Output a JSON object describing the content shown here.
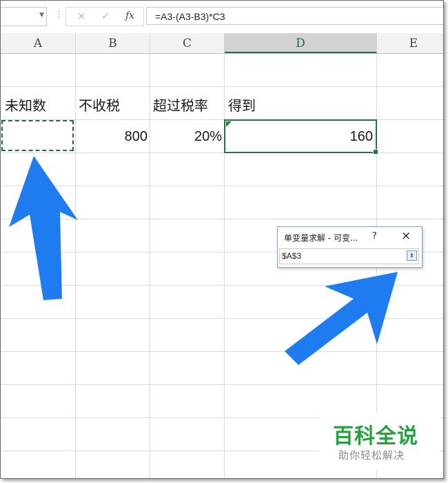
{
  "formula_bar": {
    "name_box_value": "",
    "cancel_icon": "×",
    "enter_icon": "✓",
    "fx_label": "fx",
    "formula": "=A3-(A3-B3)*C3"
  },
  "columns": [
    "A",
    "B",
    "C",
    "D",
    "E"
  ],
  "selected_column": "D",
  "cells": {
    "A2": "未知数",
    "B2": "不收税",
    "C2": "超过税率",
    "D2": "得到",
    "B3": "800",
    "C3": "20%",
    "D3": "160"
  },
  "dialog": {
    "title": "单变量求解 - 可变...",
    "help_label": "?",
    "close_label": "×",
    "input_value": "$A$3",
    "collapse_icon": "collapse-dialog-icon"
  },
  "watermark": {
    "title": "百科全说",
    "subtitle": "助你轻松解决"
  },
  "colors": {
    "excel_green": "#217346",
    "arrow_blue": "#1e7cf0",
    "watermark_green": "#25a040"
  }
}
